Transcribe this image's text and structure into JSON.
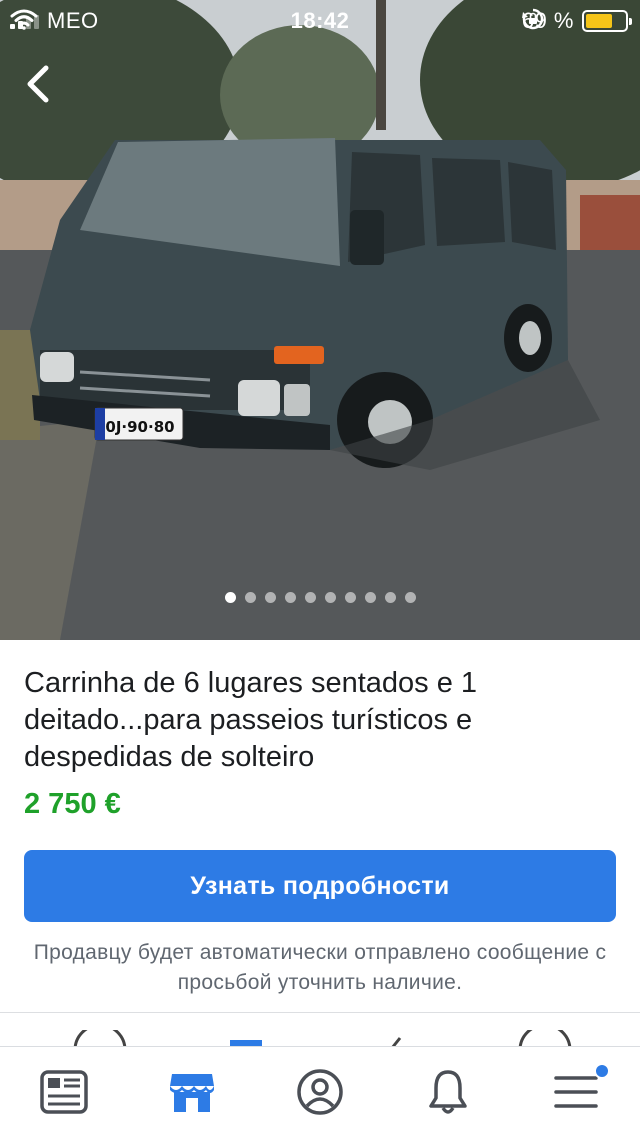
{
  "status_bar": {
    "carrier": "MEO",
    "time": "18:42",
    "battery_percent": "69 %",
    "battery_level": 0.69
  },
  "photo": {
    "plate": "0J·90·80",
    "slide_count": 10,
    "active_slide": 1
  },
  "listing": {
    "title": "Carrinha de 6 lugares sentados e 1 deitado...para passeios turísticos e despedidas de solteiro",
    "price": "2 750 €",
    "cta_label": "Узнать подробности",
    "note": "Продавцу будет автоматически отправлено сообщение с просьбой уточнить наличие."
  },
  "tabbar": {
    "items": [
      {
        "icon": "news-feed-icon"
      },
      {
        "icon": "marketplace-icon",
        "active": true
      },
      {
        "icon": "profile-icon"
      },
      {
        "icon": "notifications-icon"
      },
      {
        "icon": "menu-icon",
        "badge": true
      }
    ]
  },
  "colors": {
    "accent": "#2d7be5",
    "price": "#1fa12a",
    "text": "#1c1e21",
    "muted": "#606770"
  }
}
